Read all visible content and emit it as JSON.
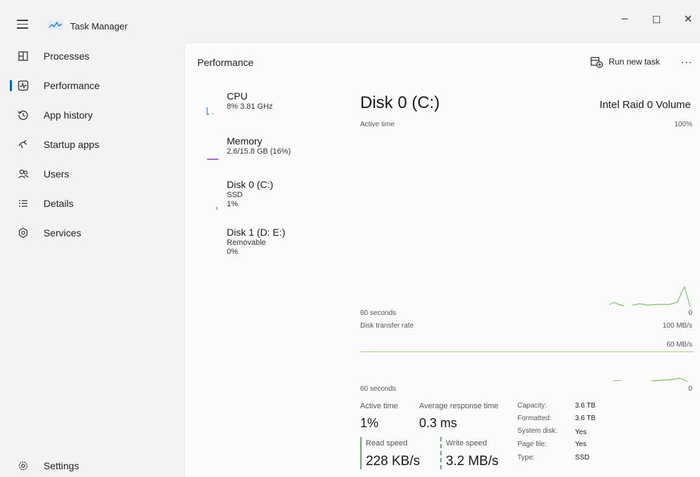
{
  "window": {
    "title": "Task Manager",
    "controls": {
      "minimize": "–",
      "maximize": "☐",
      "close": "✕"
    }
  },
  "sidebar": {
    "items": [
      {
        "label": "Processes",
        "icon": "processes-icon"
      },
      {
        "label": "Performance",
        "icon": "performance-icon",
        "active": true
      },
      {
        "label": "App history",
        "icon": "app-history-icon"
      },
      {
        "label": "Startup apps",
        "icon": "startup-apps-icon"
      },
      {
        "label": "Users",
        "icon": "users-icon"
      },
      {
        "label": "Details",
        "icon": "details-icon"
      },
      {
        "label": "Services",
        "icon": "services-icon"
      }
    ],
    "settings": {
      "label": "Settings",
      "icon": "gear-icon"
    }
  },
  "header": {
    "title": "Performance",
    "run_new_task": "Run new task",
    "more": "..."
  },
  "resources": [
    {
      "name": "CPU",
      "line1": "8% 3.81 GHz",
      "line2": "",
      "line3": ""
    },
    {
      "name": "Memory",
      "line1": "2.6/15.8 GB (16%)",
      "line2": "",
      "line3": ""
    },
    {
      "name": "Disk 0 (C:)",
      "line1": "SSD",
      "line2": "1%",
      "line3": ""
    },
    {
      "name": "Disk 1 (D: E:)",
      "line1": "Removable",
      "line2": "0%",
      "line3": ""
    }
  ],
  "detail": {
    "title": "Disk 0 (C:)",
    "model": "Intel Raid 0 Volume",
    "graph1": {
      "label": "Active time",
      "max": "100%",
      "time": "60 seconds",
      "min": "0"
    },
    "graph2": {
      "label": "Disk transfer rate",
      "max": "100 MB/s",
      "grid": "60 MB/s",
      "time": "60 seconds",
      "min": "0"
    },
    "stats": {
      "active_time_label": "Active time",
      "active_time_value": "1%",
      "avg_response_label": "Average response time",
      "avg_response_value": "0.3 ms",
      "read_label": "Read speed",
      "read_value": "228 KB/s",
      "write_label": "Write speed",
      "write_value": "3.2 MB/s"
    },
    "properties": [
      {
        "key": "Capacity:",
        "value": "3.6 TB"
      },
      {
        "key": "Formatted:",
        "value": "3.6 TB"
      },
      {
        "key": "System disk:",
        "value": "Yes"
      },
      {
        "key": "Page file:",
        "value": "Yes"
      },
      {
        "key": "Type:",
        "value": "SSD"
      }
    ]
  },
  "colors": {
    "accent": "#0067c0",
    "disk_green": "#5cb85c",
    "memory_purple": "#8b3fb8",
    "cpu_blue": "#2f7fd1"
  }
}
